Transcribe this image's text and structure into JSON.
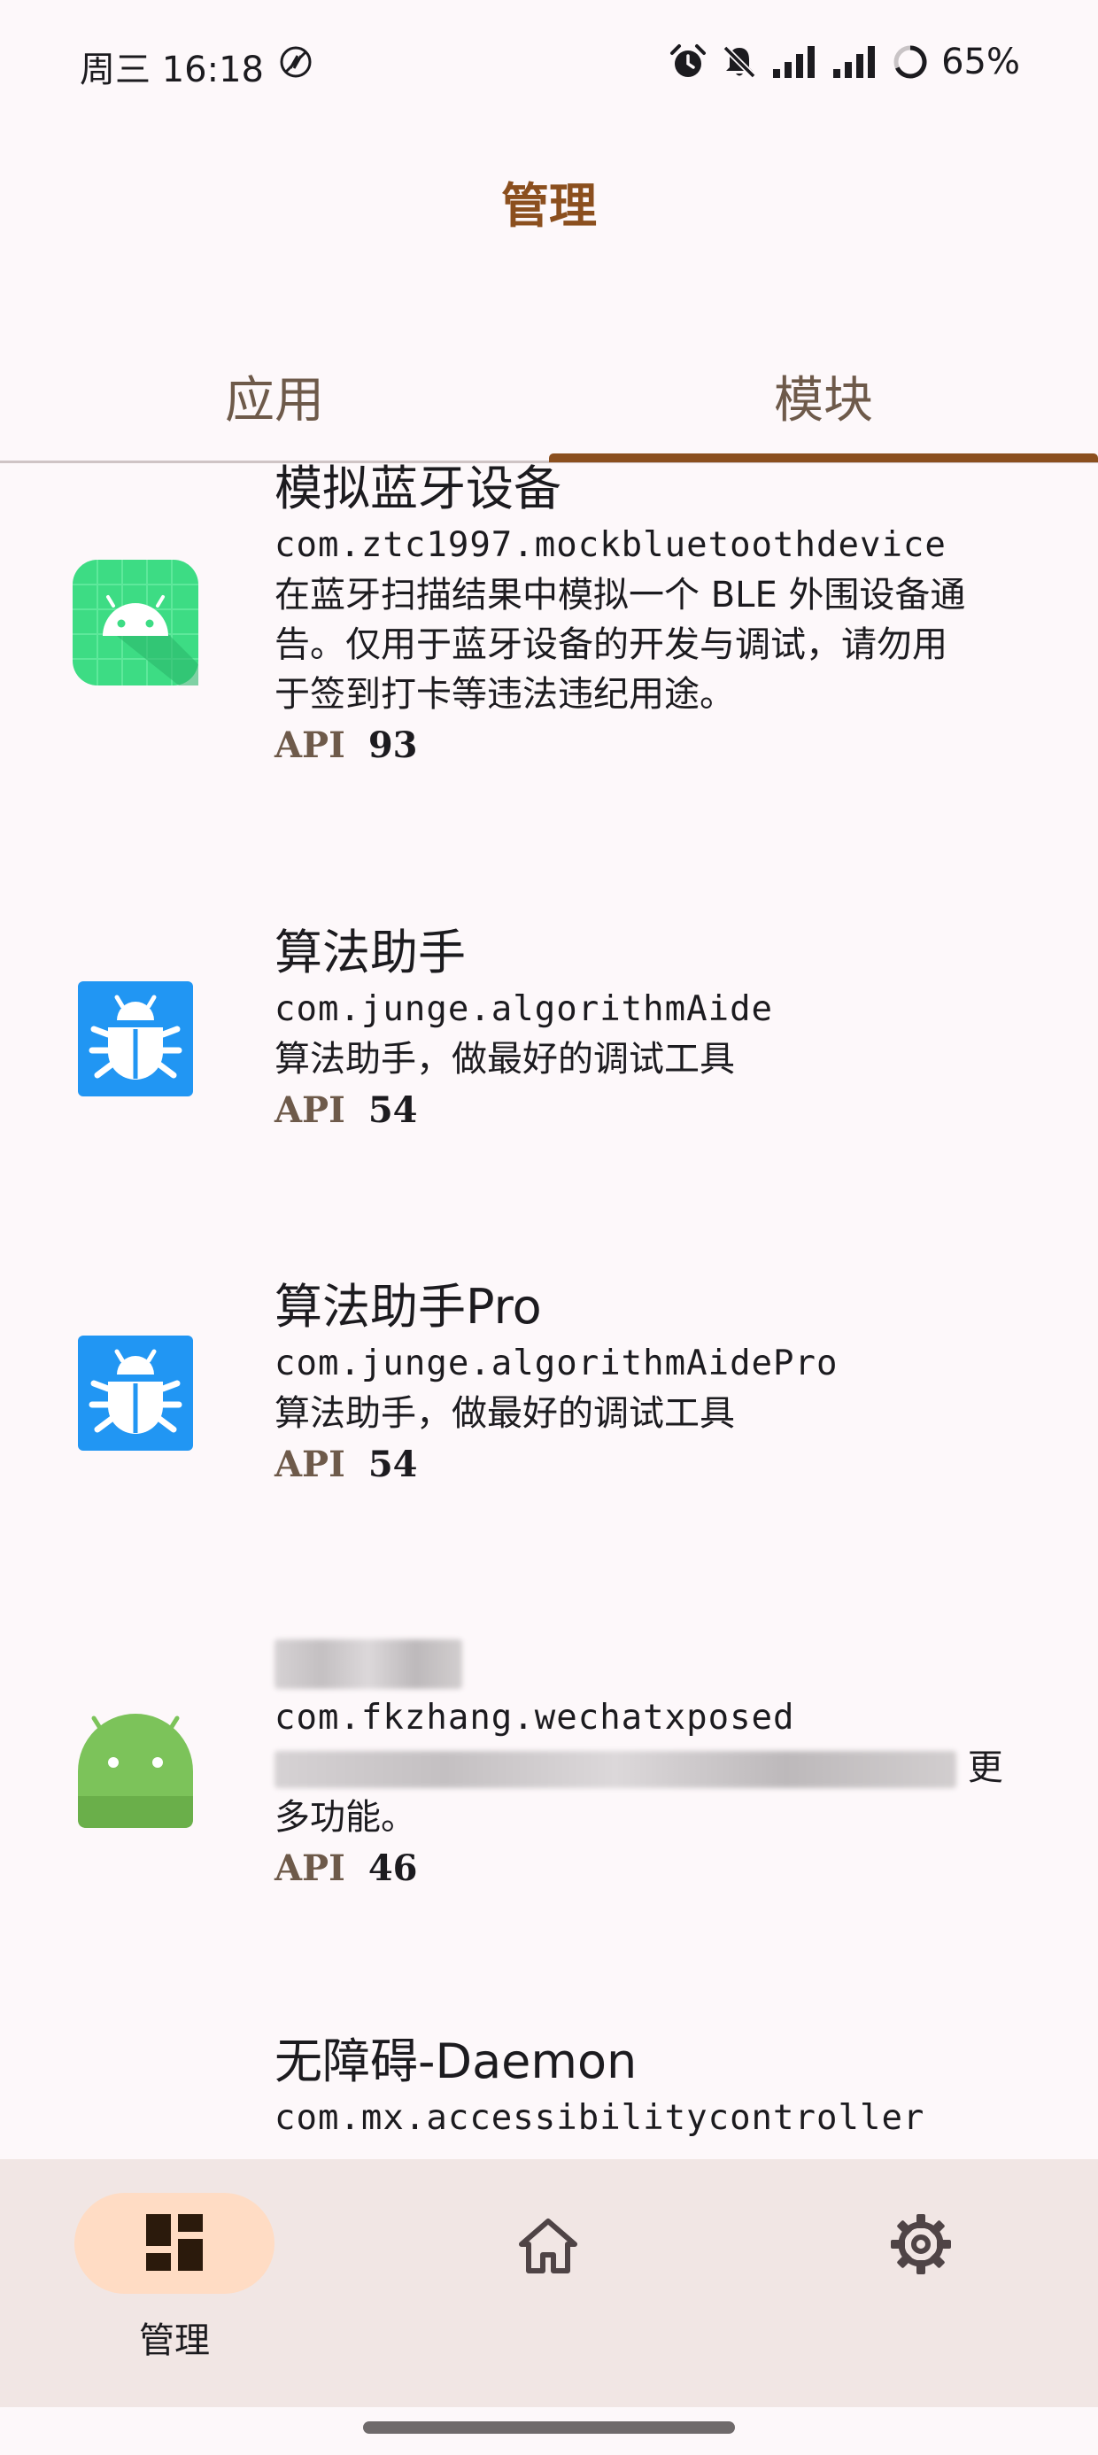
{
  "status_bar": {
    "time": "周三 16:18",
    "battery": "65%",
    "icons": [
      "nfc-off-icon",
      "alarm-icon",
      "bell-off-icon",
      "signal-icon",
      "signal-icon",
      "battery-icon"
    ]
  },
  "app_bar": {
    "title": "管理"
  },
  "tabs": [
    {
      "label": "应用",
      "selected": false
    },
    {
      "label": "模块",
      "selected": true
    }
  ],
  "modules": [
    {
      "name": "模拟蓝牙设备",
      "package": "com.ztc1997.mockbluetoothdevice",
      "description_lines": [
        "在蓝牙扫描结果中模拟一个 BLE 外围设备通",
        "告。仅用于蓝牙设备的开发与调试，请勿用",
        "于签到打卡等违法违纪用途。"
      ],
      "api_label": "API",
      "api": "93",
      "icon": "android-green-grid-icon"
    },
    {
      "name": "算法助手",
      "package": "com.junge.algorithmAide",
      "description_lines": [
        "算法助手，做最好的调试工具"
      ],
      "api_label": "API",
      "api": "54",
      "icon": "bug-blue-icon"
    },
    {
      "name": "算法助手Pro",
      "package": "com.junge.algorithmAidePro",
      "description_lines": [
        "算法助手，做最好的调试工具"
      ],
      "api_label": "API",
      "api": "54",
      "icon": "bug-blue-icon"
    },
    {
      "name": "",
      "package": "com.fkzhang.wechatxposed",
      "description_lines": [
        "更",
        "多功能。"
      ],
      "api_label": "API",
      "api": "46",
      "icon": "android-default-icon"
    },
    {
      "name": "无障碍-Daemon",
      "package": "com.mx.accessibilitycontroller",
      "icon": ""
    }
  ],
  "bottom_nav": [
    {
      "label": "管理",
      "icon": "dashboard-icon",
      "selected": true
    },
    {
      "label": "",
      "icon": "home-icon",
      "selected": false
    },
    {
      "label": "",
      "icon": "gear-icon",
      "selected": false
    }
  ],
  "colors": {
    "accent": "#8b4f1e",
    "background": "#fdf8fa",
    "nav_background": "#f1e6e4",
    "nav_pill": "#ffdcc4",
    "android_green": "#3ddc84",
    "bug_blue": "#2196f3"
  }
}
